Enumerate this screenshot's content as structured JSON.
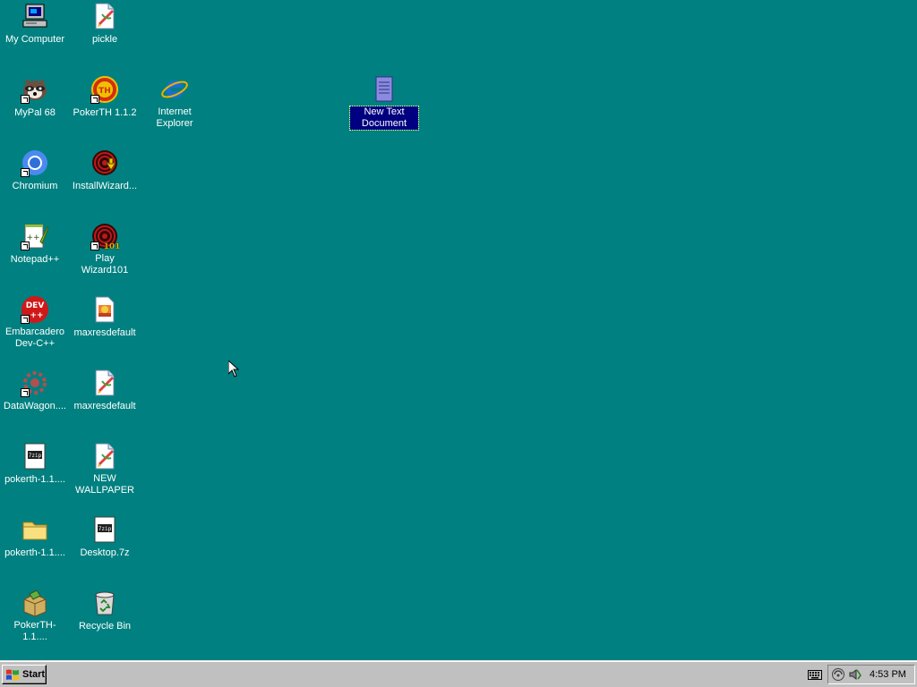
{
  "desktop": {
    "background_color": "#008080",
    "icons": [
      {
        "label": "My Computer",
        "icon": "my-computer-icon"
      },
      {
        "label": "pickle",
        "icon": "image-file-icon"
      },
      {
        "label": "MyPal 68",
        "icon": "mypal-icon"
      },
      {
        "label": "PokerTH 1.1.2",
        "icon": "pokerth-icon"
      },
      {
        "label": "Internet Explorer",
        "icon": "internet-explorer-icon"
      },
      {
        "label": "New Text Document",
        "icon": "text-document-icon"
      },
      {
        "label": "Chromium",
        "icon": "chromium-icon"
      },
      {
        "label": "InstallWizard...",
        "icon": "wizard-installer-icon"
      },
      {
        "label": "Notepad++",
        "icon": "notepad-plus-plus-icon"
      },
      {
        "label": "Play Wizard101",
        "icon": "wizard101-icon"
      },
      {
        "label": "Embarcadero Dev-C++",
        "icon": "dev-cpp-icon"
      },
      {
        "label": "maxresdefault",
        "icon": "image-file-icon"
      },
      {
        "label": "DataWagon....",
        "icon": "datawagon-icon"
      },
      {
        "label": "maxresdefault",
        "icon": "image-file-icon"
      },
      {
        "label": "pokerth-1.1....",
        "icon": "archive-file-icon"
      },
      {
        "label": "NEW WALLPAPER",
        "icon": "image-file-icon"
      },
      {
        "label": "pokerth-1.1....",
        "icon": "folder-icon"
      },
      {
        "label": "Desktop.7z",
        "icon": "archive-file-icon"
      },
      {
        "label": "PokerTH-1.1....",
        "icon": "installer-package-icon"
      },
      {
        "label": "Recycle Bin",
        "icon": "recycle-bin-icon"
      }
    ]
  },
  "taskbar": {
    "start_label": "Start",
    "clock": "4:53 PM",
    "tray_icons": [
      "network-icon",
      "volume-icon"
    ],
    "keyboard_icon": "keyboard-icon"
  }
}
